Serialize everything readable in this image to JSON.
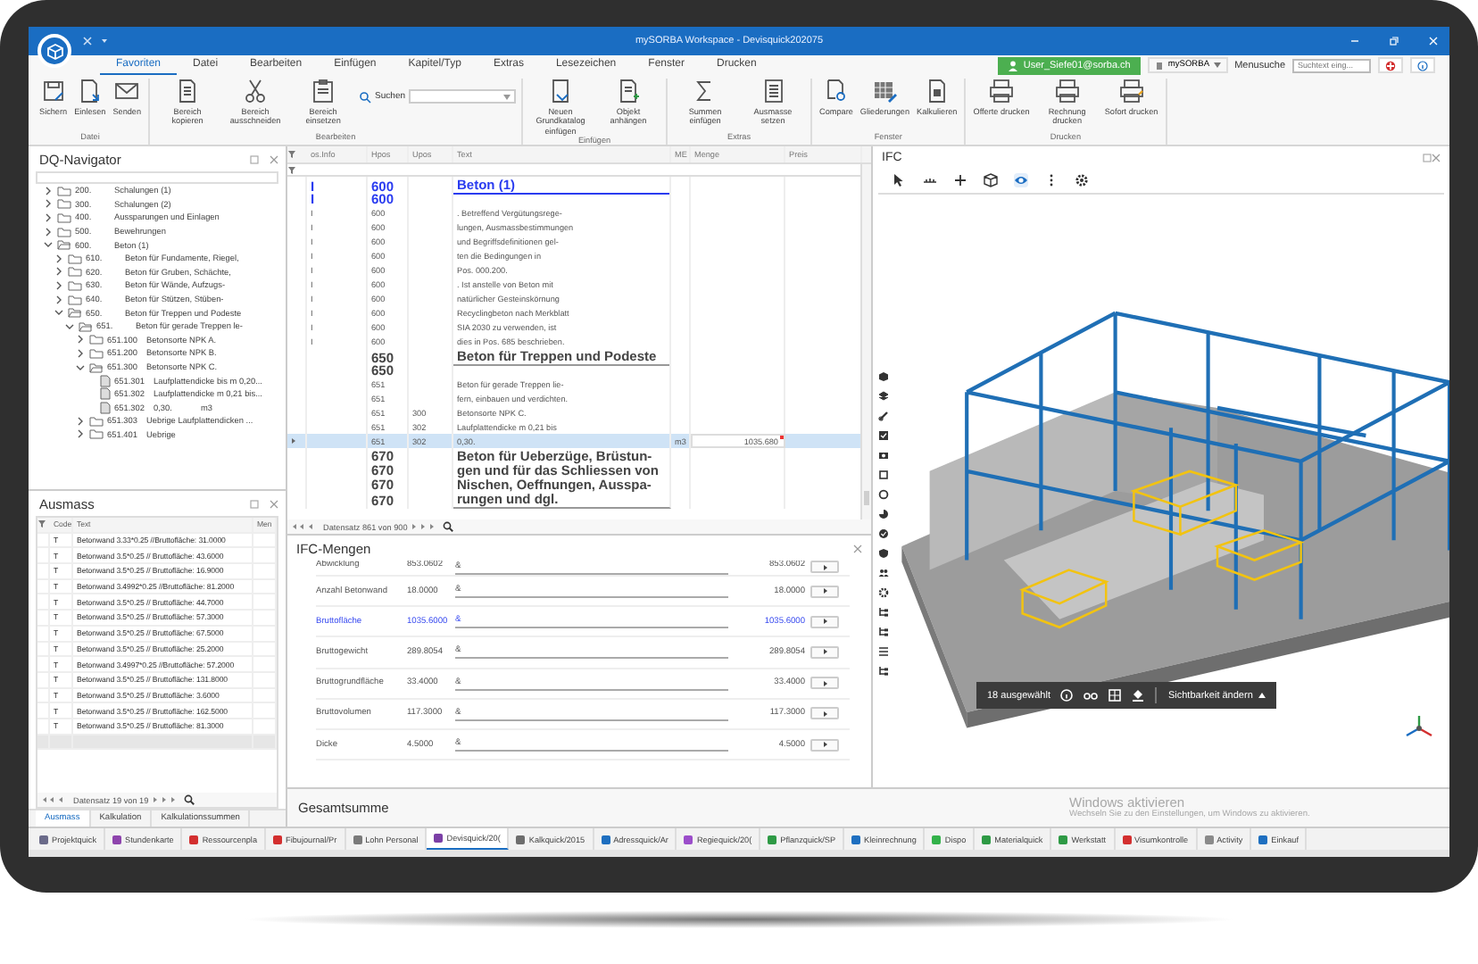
{
  "window": {
    "title": "mySORBA Workspace - Devisquick202075"
  },
  "menu": {
    "tabs": [
      {
        "label": "Favoriten",
        "selected": true
      },
      {
        "label": "Datei",
        "selected": false
      },
      {
        "label": "Bearbeiten",
        "selected": false
      },
      {
        "label": "Einfügen",
        "selected": false
      },
      {
        "label": "Kapitel/Typ",
        "selected": false
      },
      {
        "label": "Extras",
        "selected": false
      },
      {
        "label": "Lesezeichen",
        "selected": false
      },
      {
        "label": "Fenster",
        "selected": false
      },
      {
        "label": "Drucken",
        "selected": false
      }
    ],
    "user": "User_Siefe01@sorba.ch",
    "workspace": "mySORBA",
    "menu_search": {
      "label": "Menusuche",
      "placeholder": "Suchtext eing..."
    }
  },
  "ribbon": {
    "groups": [
      {
        "title": "Datei",
        "buttons": [
          "Sichern",
          "Einlesen",
          "Senden"
        ]
      },
      {
        "title": "Bearbeiten",
        "buttons": [
          "Bereich kopieren",
          "Bereich ausschneiden",
          "Bereich einsetzen"
        ],
        "search": {
          "label": "Suchen"
        }
      },
      {
        "title": "Einfügen",
        "buttons": [
          "Neuen Grundkatalog einfügen",
          "Objekt anhängen"
        ]
      },
      {
        "title": "Extras",
        "buttons": [
          "Summen einfügen",
          "Ausmasse setzen"
        ]
      },
      {
        "title": "Fenster",
        "buttons": [
          "Compare",
          "Gliederungen",
          "Kalkulieren"
        ]
      },
      {
        "title": "Drucken",
        "buttons": [
          "Offerte drucken",
          "Rechnung drucken",
          "Sofort drucken"
        ]
      }
    ]
  },
  "navigator": {
    "title": "DQ-Navigator",
    "tree": [
      {
        "kind": "folder",
        "number": "200.",
        "label": "Schalungen (1)",
        "expanded": false
      },
      {
        "kind": "folder",
        "number": "300.",
        "label": "Schalungen (2)",
        "expanded": false
      },
      {
        "kind": "folder",
        "number": "400.",
        "label": "Aussparungen und Einlagen",
        "expanded": false
      },
      {
        "kind": "folder",
        "number": "500.",
        "label": "Bewehrungen",
        "expanded": false
      },
      {
        "kind": "folder",
        "number": "600.",
        "label": "Beton (1)",
        "expanded": true,
        "children": [
          {
            "kind": "folder",
            "number": "610.",
            "label": "Beton für Fundamente, Riegel,",
            "expanded": false
          },
          {
            "kind": "folder",
            "number": "620.",
            "label": "Beton für Gruben, Schächte,",
            "expanded": false
          },
          {
            "kind": "folder",
            "number": "630.",
            "label": "Beton für Wände, Aufzugs-",
            "expanded": false
          },
          {
            "kind": "folder",
            "number": "640.",
            "label": "Beton für Stützen, Stüben-",
            "expanded": false
          },
          {
            "kind": "folder",
            "number": "650.",
            "label": "Beton für Treppen und Podeste",
            "expanded": true,
            "children": [
              {
                "kind": "folder",
                "number": "651.",
                "label": "Beton für gerade Treppen le-",
                "expanded": true,
                "children": [
                  {
                    "kind": "folder",
                    "number": "651.100",
                    "label": "Betonsorte NPK A.",
                    "expanded": false
                  },
                  {
                    "kind": "folder",
                    "number": "651.200",
                    "label": "Betonsorte NPK B.",
                    "expanded": false
                  },
                  {
                    "kind": "folder",
                    "number": "651.300",
                    "label": "Betonsorte NPK C.",
                    "expanded": true,
                    "children": [
                      {
                        "kind": "position",
                        "number": "651.301",
                        "label": "Laufplattendicke bis m 0,20..."
                      },
                      {
                        "kind": "position",
                        "number": "651.302",
                        "label": "Laufplattendicke m 0,21 bis..."
                      },
                      {
                        "kind": "position",
                        "number": "651.302",
                        "label": "0,30.",
                        "unit": "m3"
                      }
                    ]
                  },
                  {
                    "kind": "folder",
                    "number": "651.303",
                    "label": "Uebrige Laufplattendicken ...",
                    "expanded": false
                  },
                  {
                    "kind": "folder",
                    "number": "651.401",
                    "label": "Uebrige",
                    "expanded": false
                  }
                ]
              }
            ]
          }
        ]
      }
    ]
  },
  "grid": {
    "columns": [
      "os.Info",
      "Hpos",
      "Upos",
      "Text",
      "ME",
      "Menge",
      "Preis"
    ],
    "rows": [
      {
        "kind": "title",
        "info": "I",
        "hpos": "600",
        "text": "Beton (1)",
        "selected": false
      },
      {
        "kind": "title",
        "info": "I",
        "hpos": "600",
        "selected": false
      },
      {
        "kind": "text",
        "info": "I",
        "hpos": "600",
        "text": ". Betreffend Vergütungsrege-",
        "selected": false
      },
      {
        "kind": "text",
        "info": "I",
        "hpos": "600",
        "text": "lungen, Ausmassbestimmungen",
        "selected": false
      },
      {
        "kind": "text",
        "info": "I",
        "hpos": "600",
        "text": "und Begriffsdefinitionen gel-",
        "selected": false
      },
      {
        "kind": "text",
        "info": "I",
        "hpos": "600",
        "text": "ten die Bedingungen in",
        "selected": false
      },
      {
        "kind": "text",
        "info": "I",
        "hpos": "600",
        "text": "Pos. 000.200.",
        "selected": false
      },
      {
        "kind": "text",
        "info": "I",
        "hpos": "600",
        "text": ". Ist anstelle von Beton mit",
        "selected": false
      },
      {
        "kind": "text",
        "info": "I",
        "hpos": "600",
        "text": "natürlicher Gesteinskörnung",
        "selected": false
      },
      {
        "kind": "text",
        "info": "I",
        "hpos": "600",
        "text": "Recyclingbeton nach Merkblatt",
        "selected": false
      },
      {
        "kind": "text",
        "info": "I",
        "hpos": "600",
        "text": "SIA 2030 zu verwenden, ist",
        "selected": false
      },
      {
        "kind": "text",
        "info": "I",
        "hpos": "600",
        "text": "dies in Pos. 685 beschrieben.",
        "selected": false
      },
      {
        "kind": "heading",
        "hpos": "650",
        "text": "Beton für Treppen und Podeste",
        "selected": false
      },
      {
        "kind": "heading",
        "hpos": "650",
        "selected": false
      },
      {
        "kind": "text",
        "hpos": "651",
        "text": "Beton für gerade Treppen lie-",
        "selected": false
      },
      {
        "kind": "text",
        "hpos": "651",
        "text": "fern, einbauen und verdichten.",
        "selected": false
      },
      {
        "kind": "text",
        "hpos": "651",
        "upos": "300",
        "text": "Betonsorte NPK C.",
        "selected": false
      },
      {
        "kind": "text",
        "hpos": "651",
        "upos": "302",
        "text": "Laufplattendicke m 0,21 bis",
        "selected": false
      },
      {
        "kind": "text",
        "hpos": "651",
        "upos": "302",
        "text": "0,30.",
        "me": "m3",
        "menge": "1035.680",
        "selected": true
      },
      {
        "kind": "heading",
        "hpos": "670",
        "text": "Beton für Ueberzüge, Brüstun-",
        "selected": false
      },
      {
        "kind": "heading",
        "hpos": "670",
        "text": "gen und für das Schliessen von",
        "selected": false
      },
      {
        "kind": "heading",
        "hpos": "670",
        "text": "Nischen, Oeffnungen, Ausspa-",
        "selected": false
      },
      {
        "kind": "heading",
        "hpos": "670",
        "text": "rungen und dgl.",
        "selected": false
      }
    ],
    "footer": "Datensatz 861 von 900"
  },
  "ausmass": {
    "title": "Ausmass",
    "columns": [
      "Code",
      "Text",
      "Men"
    ],
    "rows": [
      {
        "code": "T",
        "text": "Betonwand 3.33*0.25 //Bruttofläche: 31.0000"
      },
      {
        "code": "T",
        "text": "Betonwand 3.5*0.25 // Bruttofläche: 43.6000"
      },
      {
        "code": "T",
        "text": "Betonwand 3.5*0.25 // Bruttofläche: 16.9000"
      },
      {
        "code": "T",
        "text": "Betonwand 3.4992*0.25 //Bruttofläche: 81.2000"
      },
      {
        "code": "T",
        "text": "Betonwand 3.5*0.25 // Bruttofläche: 44.7000"
      },
      {
        "code": "T",
        "text": "Betonwand 3.5*0.25 // Bruttofläche: 57.3000"
      },
      {
        "code": "T",
        "text": "Betonwand 3.5*0.25 // Bruttofläche: 67.5000"
      },
      {
        "code": "T",
        "text": "Betonwand 3.5*0.25 // Bruttofläche: 25.2000"
      },
      {
        "code": "T",
        "text": "Betonwand 3.4997*0.25 //Bruttofläche: 57.2000"
      },
      {
        "code": "T",
        "text": "Betonwand 3.5*0.25 // Bruttofläche: 131.8000"
      },
      {
        "code": "T",
        "text": "Betonwand 3.5*0.25 // Bruttofläche: 3.6000"
      },
      {
        "code": "T",
        "text": "Betonwand 3.5*0.25 // Bruttofläche: 162.5000"
      },
      {
        "code": "T",
        "text": "Betonwand 3.5*0.25 // Bruttofläche: 81.3000"
      }
    ],
    "footer": "Datensatz 19 von 19",
    "tabs": [
      {
        "label": "Ausmass",
        "selected": true
      },
      {
        "label": "Kalkulation",
        "selected": false
      },
      {
        "label": "Kalkulationssummen",
        "selected": false
      }
    ]
  },
  "ifc_mengen": {
    "title": "IFC-Mengen",
    "rows": [
      {
        "name": "Abwicklung",
        "value": "853.0602",
        "formula": "&",
        "result": "853.0602",
        "highlighted": false
      },
      {
        "name": "Anzahl Betonwand",
        "value": "18.0000",
        "formula": "&",
        "result": "18.0000",
        "highlighted": false
      },
      {
        "name": "Bruttofläche",
        "value": "1035.6000",
        "formula": "&",
        "result": "1035.6000",
        "highlighted": true
      },
      {
        "name": "Bruttogewicht",
        "value": "289.8054",
        "formula": "&",
        "result": "289.8054",
        "highlighted": false
      },
      {
        "name": "Bruttogrundfläche",
        "value": "33.4000",
        "formula": "&",
        "result": "33.4000",
        "highlighted": false
      },
      {
        "name": "Bruttovolumen",
        "value": "117.3000",
        "formula": "&",
        "result": "117.3000",
        "highlighted": false
      },
      {
        "name": "Dicke",
        "value": "4.5000",
        "formula": "&",
        "result": "4.5000",
        "highlighted": false
      }
    ]
  },
  "gesamtsumme": {
    "title": "Gesamtsumme"
  },
  "ifc_viewer": {
    "title": "IFC",
    "selection": "18 ausgewählt",
    "visibility_button": "Sichtbarkeit ändern"
  },
  "windows_notice": {
    "title": "Windows aktivieren",
    "text": "Wechseln Sie zu den Einstellungen, um Windows zu aktivieren."
  },
  "taskbar": {
    "tabs": [
      {
        "label": "Projektquick",
        "color": "#6b6b8a",
        "selected": false
      },
      {
        "label": "Stundenkarte",
        "color": "#8e44ad",
        "selected": false
      },
      {
        "label": "Ressourcenpla",
        "color": "#d32f2f",
        "selected": false
      },
      {
        "label": "Fibujournal/Pr",
        "color": "#d32f2f",
        "selected": false
      },
      {
        "label": "Lohn Personal",
        "color": "#7a7a7a",
        "selected": false
      },
      {
        "label": "Devisquick/20(",
        "color": "#7b3fa6",
        "selected": true
      },
      {
        "label": "Kalkquick/2015",
        "color": "#6d6d6d",
        "selected": false
      },
      {
        "label": "Adressquick/Ar",
        "color": "#1e6fc0",
        "selected": false
      },
      {
        "label": "Regiequick/20(",
        "color": "#9b4dca",
        "selected": false
      },
      {
        "label": "Pflanzquick/SP",
        "color": "#2e9a45",
        "selected": false
      },
      {
        "label": "Kleinrechnung",
        "color": "#1e6fc0",
        "selected": false
      },
      {
        "label": "Dispo",
        "color": "#33b24a",
        "selected": false
      },
      {
        "label": "Materialquick",
        "color": "#2e9a45",
        "selected": false
      },
      {
        "label": "Werkstatt",
        "color": "#2e9a45",
        "selected": false
      },
      {
        "label": "Visumkontrolle",
        "color": "#d32f2f",
        "selected": false
      },
      {
        "label": "Activity",
        "color": "#8a8a8a",
        "selected": false
      },
      {
        "label": "Einkauf",
        "color": "#1e6fc0",
        "selected": false
      }
    ]
  }
}
